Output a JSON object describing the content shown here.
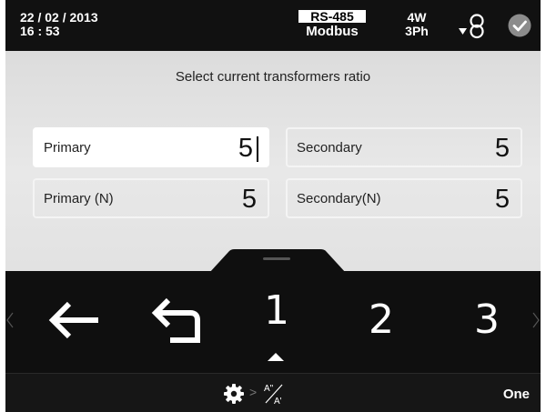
{
  "status": {
    "date": "22 / 02 / 2013",
    "time": "16 : 53",
    "protocol": "RS-485",
    "protocol_mode": "Modbus",
    "wires": "4W",
    "phases": "3Ph"
  },
  "form": {
    "instruction": "Select current transformers ratio",
    "fields": [
      {
        "label": "Primary",
        "value": "5"
      },
      {
        "label": "Secondary",
        "value": "5"
      },
      {
        "label": "Primary (N)",
        "value": "5"
      },
      {
        "label": "Secondary(N)",
        "value": "5"
      }
    ]
  },
  "keypad": {
    "keys": [
      "1",
      "2",
      "3"
    ]
  },
  "bottombar": {
    "sep": ">",
    "mode_label": "One"
  },
  "icons": {
    "back": "arrow-left-icon",
    "return": "return-icon",
    "ct": "current-transformer-icon",
    "ok": "check-circle-icon",
    "settings": "gear-icon",
    "ratio": "ratio-icon"
  },
  "colors": {
    "screen_bg": "#101010",
    "form_bg": "#e0e0e0",
    "active_field_bg": "#ffffff",
    "ok_icon": "#8c8c8c"
  }
}
